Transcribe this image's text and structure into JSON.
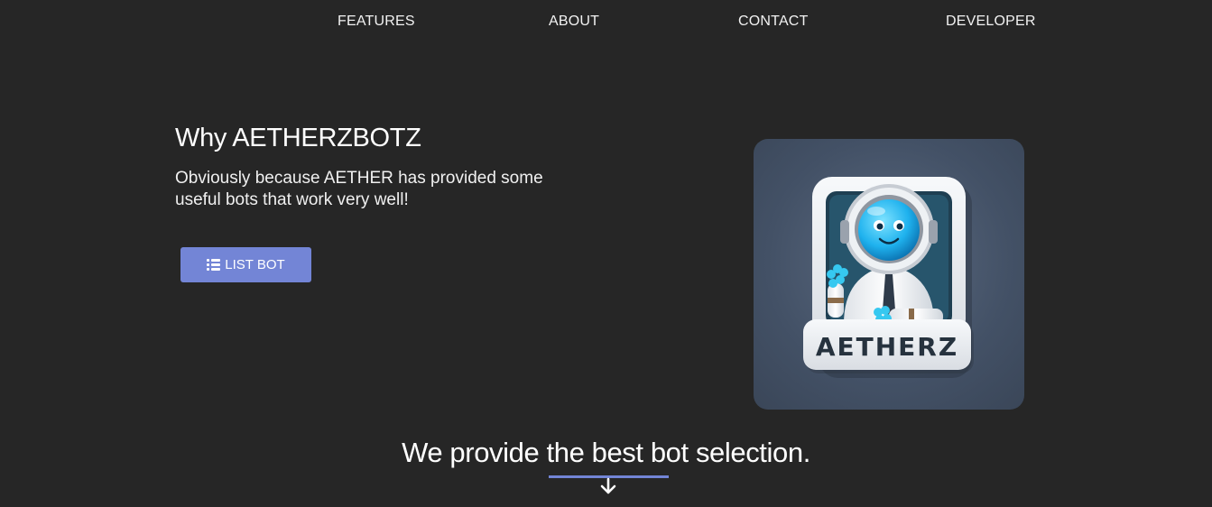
{
  "nav": {
    "items": [
      {
        "label": "FEATURES"
      },
      {
        "label": "ABOUT"
      },
      {
        "label": "CONTACT"
      },
      {
        "label": "DEVELOPER"
      }
    ]
  },
  "hero": {
    "title": "Why AETHERZBOTZ",
    "subtitle": "Obviously because AETHER has provided some useful bots that work very well!",
    "button": {
      "label": "LIST BOT",
      "icon": "list-icon"
    },
    "logo": {
      "text": "AETHERZ"
    }
  },
  "section": {
    "title": "We provide the best bot selection.",
    "icon": "arrow-down-icon"
  },
  "colors": {
    "background": "#262626",
    "accent": "#7385d6",
    "text": "#ffffff",
    "card": "#435166"
  }
}
